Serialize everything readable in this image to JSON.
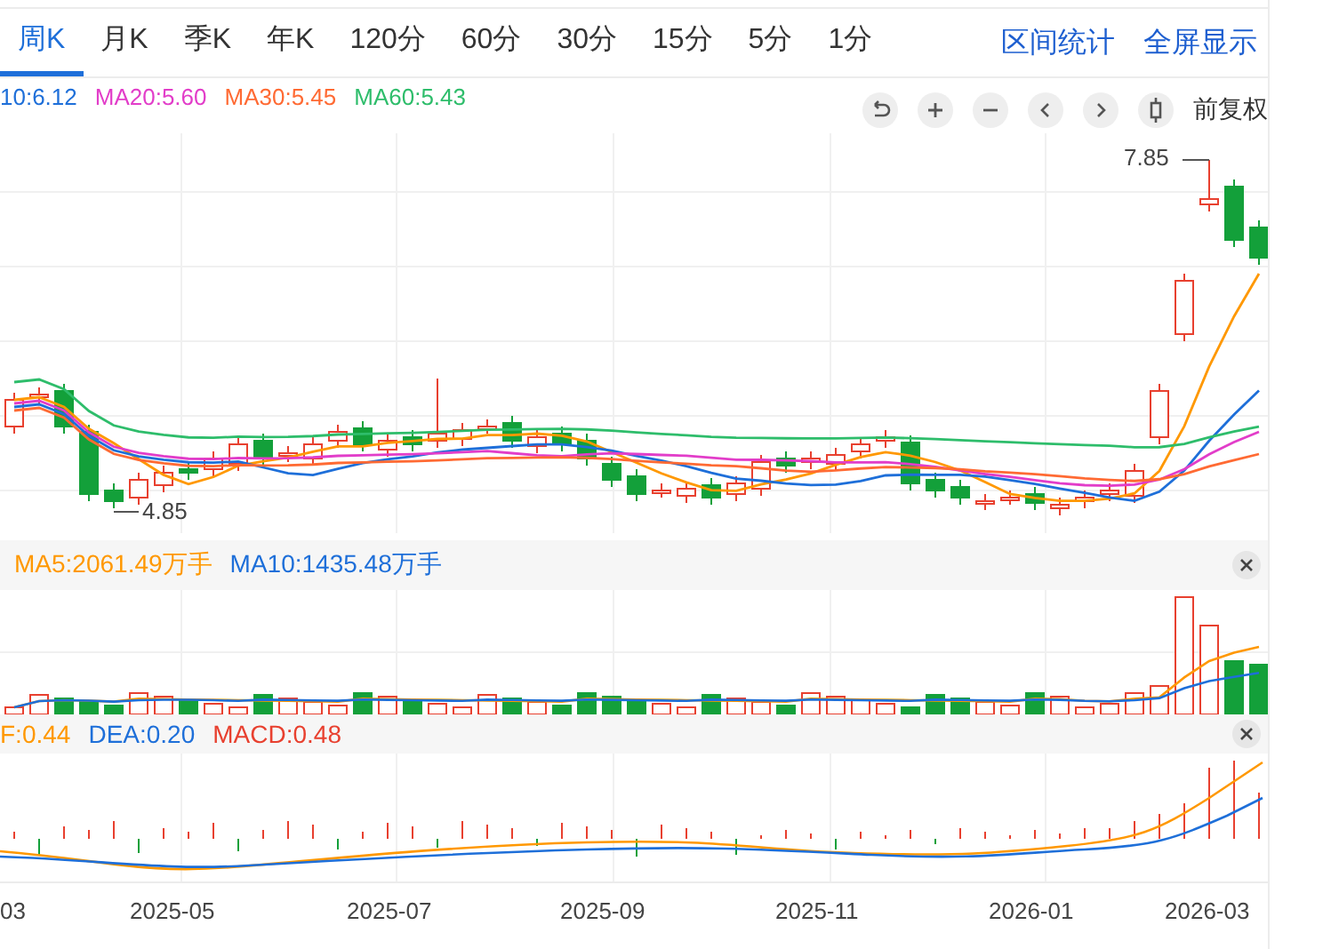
{
  "tabs": [
    {
      "label": "周K",
      "selected": true
    },
    {
      "label": "月K",
      "selected": false
    },
    {
      "label": "季K",
      "selected": false
    },
    {
      "label": "年K",
      "selected": false
    },
    {
      "label": "120分",
      "selected": false
    },
    {
      "label": "60分",
      "selected": false
    },
    {
      "label": "30分",
      "selected": false
    },
    {
      "label": "15分",
      "selected": false
    },
    {
      "label": "5分",
      "selected": false
    },
    {
      "label": "1分",
      "selected": false
    }
  ],
  "links": [
    "区间统计",
    "全屏显示"
  ],
  "main_legend": [
    {
      "text": "10:6.12",
      "color": "#1e6fd9"
    },
    {
      "text": "MA20:5.60",
      "color": "#e23dc9"
    },
    {
      "text": "MA30:5.45",
      "color": "#ff6a33"
    },
    {
      "text": "MA60:5.43",
      "color": "#2ebd6b"
    }
  ],
  "adjust_label": "前复权",
  "price_chart": {
    "high_label": "7.85",
    "low_label": "4.85"
  },
  "volume_legend": [
    {
      "text": "MA5:2061.49万手",
      "color": "#ff9800"
    },
    {
      "text": "MA10:1435.48万手",
      "color": "#1e6fd9"
    }
  ],
  "macd_legend": [
    {
      "text": "F:0.44",
      "color": "#ff9800"
    },
    {
      "text": "DEA:0.20",
      "color": "#1e6fd9"
    },
    {
      "text": "MACD:0.48",
      "color": "#e8402f"
    }
  ],
  "x_axis_labels": [
    "03",
    "2025-05",
    "2025-07",
    "2025-09",
    "2025-11",
    "2026-01",
    "2026-03"
  ]
}
